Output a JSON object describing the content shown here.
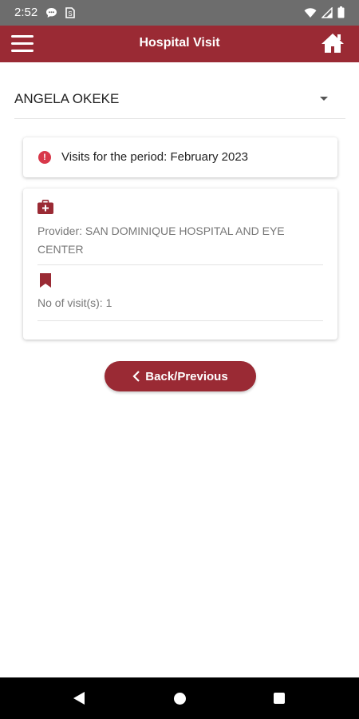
{
  "status_bar": {
    "time": "2:52",
    "icons": [
      "chat-icon",
      "sim-icon",
      "wifi-icon",
      "signal-icon",
      "battery-icon"
    ]
  },
  "app_bar": {
    "title": "Hospital Visit",
    "menu_icon": "menu-icon",
    "home_icon": "home-icon"
  },
  "patient_select": {
    "selected": "ANGELA OKEKE"
  },
  "period_card": {
    "icon": "info-icon",
    "text": "Visits for the period: February 2023"
  },
  "visit_details": {
    "provider_icon": "medkit-icon",
    "provider": "Provider: SAN DOMINIQUE HOSPITAL AND EYE CENTER",
    "visits_icon": "bookmark-icon",
    "visits": "No of visit(s): 1"
  },
  "back_button": {
    "label": "Back/Previous"
  },
  "colors": {
    "primary": "#9a2a34",
    "info": "#d8384a",
    "status_bar": "#6d6d6d"
  }
}
